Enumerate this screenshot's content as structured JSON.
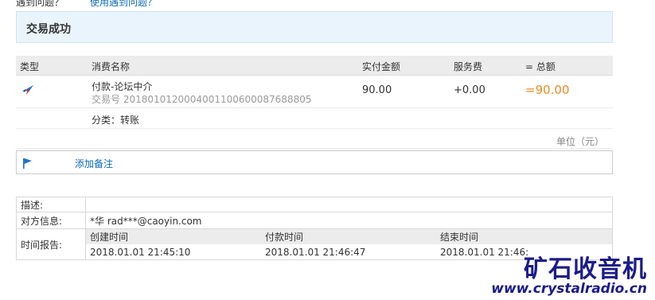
{
  "top": {
    "left_text": "遇到问题？",
    "help_link": "使用遇到问题？"
  },
  "status": {
    "title": "交易成功"
  },
  "table": {
    "headers": [
      "类型",
      "消费名称",
      "实付金额",
      "服务费",
      "= 总额"
    ],
    "row": {
      "name": "付款-论坛中介",
      "trade_no": "交易号 2018010120004001100600087688805",
      "amount": "90.00",
      "fee": "+0.00",
      "total": "=90.00",
      "category": "分类：转账"
    }
  },
  "unit": "单位（元）",
  "note": {
    "add_label": "添加备注"
  },
  "info": {
    "desc_label": "描述:",
    "desc_value": "",
    "party_label": "对方信息:",
    "party_value": "*华 rad***@caoyin.com",
    "time_label": "时间报告:",
    "created_label": "创建时间",
    "paid_label": "付款时间",
    "ended_label": "结束时间",
    "created_value": "2018.01.01 21:45:10",
    "paid_value": "2018.01.01 21:46:47",
    "ended_value": "2018.01.01 21:46:"
  },
  "watermark": {
    "title": "矿石收音机",
    "url": "www.crystalradio.cn"
  },
  "colors": {
    "accent": "#f08a24",
    "link": "#0e6cb8",
    "banner_bg": "#eaf4fc",
    "icon_blue": "#1e6fd9"
  }
}
